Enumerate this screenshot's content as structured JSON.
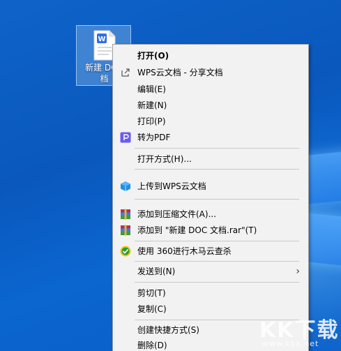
{
  "desktop_icon": {
    "label": "新建 DOC 文档",
    "label_visible": "新建 DOC\n档",
    "icon": "wps-word-doc-icon"
  },
  "context_menu": {
    "items": [
      {
        "label": "打开(O)",
        "icon": "",
        "bold": true
      },
      {
        "label": "WPS云文档 - 分享文档",
        "icon": "share-icon"
      },
      {
        "label": "编辑(E)",
        "icon": ""
      },
      {
        "label": "新建(N)",
        "icon": ""
      },
      {
        "label": "打印(P)",
        "icon": ""
      },
      {
        "label": "转为PDF",
        "icon": "pdf-convert-icon"
      },
      {
        "label": "打开方式(H)...",
        "icon": ""
      },
      {
        "label": "上传到WPS云文档",
        "icon": "wps-cloud-icon"
      },
      {
        "label": "添加到压缩文件(A)...",
        "icon": "winrar-icon"
      },
      {
        "label": "添加到 \"新建 DOC 文档.rar\"(T)",
        "icon": "winrar-icon"
      },
      {
        "label": "使用 360进行木马云查杀",
        "icon": "360-scan-icon"
      },
      {
        "label": "发送到(N)",
        "icon": "",
        "submenu": true
      },
      {
        "label": "剪切(T)",
        "icon": ""
      },
      {
        "label": "复制(C)",
        "icon": ""
      },
      {
        "label": "创建快捷方式(S)",
        "icon": ""
      },
      {
        "label": "删除(D)",
        "icon": ""
      }
    ],
    "submenu_arrow": "›"
  },
  "watermark": {
    "logo_text": "KK下载",
    "url": "www.kkx.net"
  },
  "colors": {
    "desktop_blue": "#0b5fc6",
    "menu_bg": "#f2f2f2",
    "pdf_purple": "#6b5cf0",
    "wps_cloud_blue": "#1e8fe6",
    "scan_green": "#2f9e2f"
  }
}
